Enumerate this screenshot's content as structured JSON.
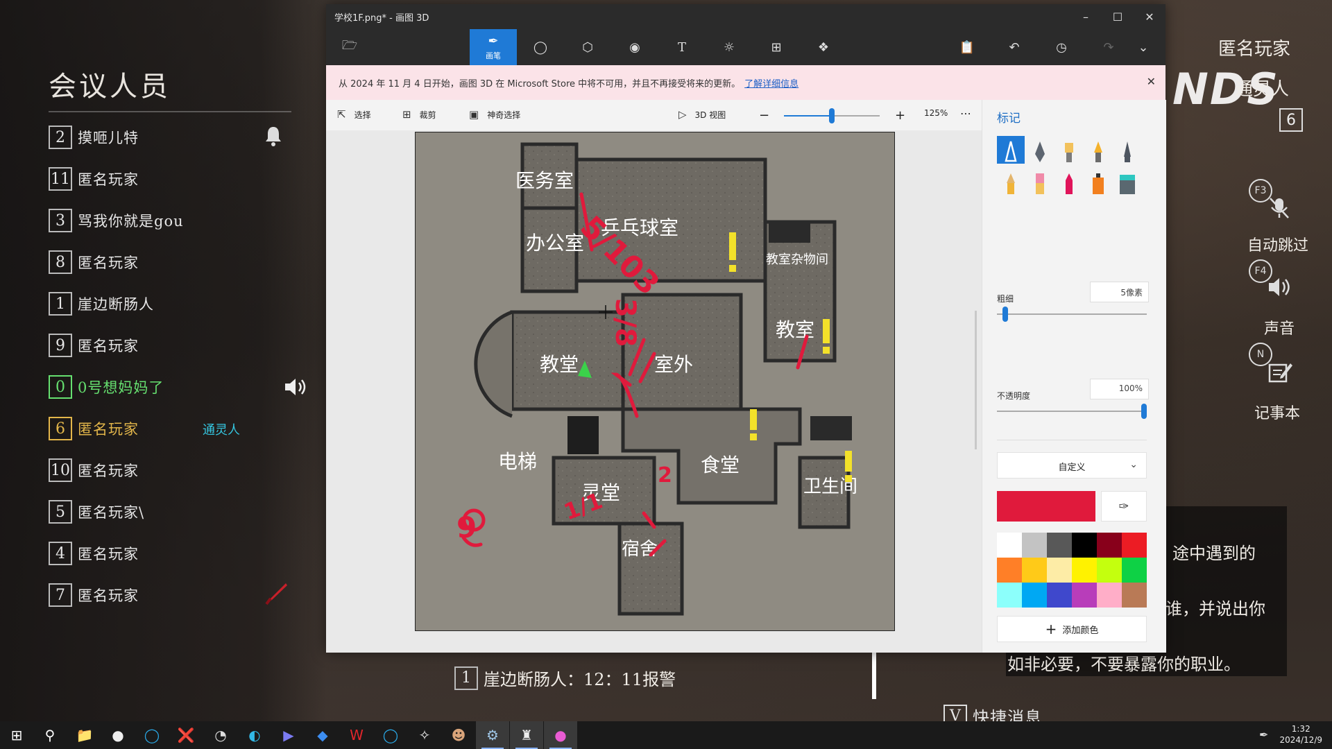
{
  "meeting": {
    "title": "会议人员",
    "players": [
      {
        "num": "2",
        "name": "摸咂儿特"
      },
      {
        "num": "11",
        "name": "匿名玩家"
      },
      {
        "num": "3",
        "name": "骂我你就是gou"
      },
      {
        "num": "8",
        "name": "匿名玩家"
      },
      {
        "num": "1",
        "name": "崖边断肠人"
      },
      {
        "num": "9",
        "name": "匿名玩家"
      },
      {
        "num": "0",
        "name": "0号想妈妈了",
        "status": "speaking"
      },
      {
        "num": "6",
        "name": "匿名玩家",
        "role": "通灵人"
      },
      {
        "num": "10",
        "name": "匿名玩家"
      },
      {
        "num": "5",
        "name": "匿名玩家\\"
      },
      {
        "num": "4",
        "name": "匿名玩家"
      },
      {
        "num": "7",
        "name": "匿名玩家"
      }
    ]
  },
  "hud": {
    "self_name": "匿名玩家",
    "self_role": "通灵人",
    "self_number": "6",
    "logo_text": "NDS",
    "key_f3": "F3",
    "auto_skip": "自动跳过",
    "key_f4": "F4",
    "sound": "声音",
    "key_n": "N",
    "notebook": "记事本",
    "info_lines": [
      "途中遇到的",
      "谁，并说出你",
      "如非必要，不要暴露你的职业。"
    ],
    "chat": {
      "num": "1",
      "text": "崖边断肠人：12：11报警"
    },
    "quick_msg": {
      "key": "V",
      "text": "快捷消息"
    }
  },
  "paint3d": {
    "window_title": "学校1F.png* - 画图 3D",
    "toolbar": {
      "brushes_label": "画笔"
    },
    "notice": {
      "text": "从 2024 年 11 月 4 日开始，画图 3D 在 Microsoft Store 中将不可用，并且不再接受将来的更新。",
      "link": "了解详细信息"
    },
    "commands": {
      "select": "选择",
      "crop": "裁剪",
      "magic_select": "神奇选择",
      "view3d": "3D 视图",
      "zoom": "125%"
    },
    "zoom_level": 0.5,
    "side_panel": {
      "title": "标记",
      "thickness_label": "粗细",
      "thickness_value": "5像素",
      "thickness_level": 0.04,
      "opacity_label": "不透明度",
      "opacity_value": "100%",
      "opacity_level": 1.0,
      "color_mode": "自定义",
      "selected_color": "#e01a3c",
      "add_color_label": "添加颜色",
      "palette": [
        "#ffffff",
        "#c3c3c3",
        "#585858",
        "#000000",
        "#88001b",
        "#ec1c24",
        "#ff7f27",
        "#ffca18",
        "#fdeca6",
        "#fff200",
        "#c4ff0e",
        "#0ed145",
        "#8cfffb",
        "#00a8f3",
        "#3f48cc",
        "#b83dba",
        "#ffaec8",
        "#b97a56"
      ]
    },
    "map": {
      "rooms": {
        "infirmary": "医务室",
        "office": "办公室",
        "pingpong": "乒乓球室",
        "storage": "教室杂物间",
        "chapel": "教堂",
        "outdoor": "室外",
        "classroom": "教室",
        "elevator": "电梯",
        "spirit_hall": "灵堂",
        "canteen": "食堂",
        "toilet": "卫生间",
        "dorm": "宿舍"
      },
      "annotations": {
        "a": "5/103",
        "b": "3/8",
        "c": "9",
        "d": "1/1",
        "e": "2"
      }
    }
  },
  "taskbar": {
    "time": "1:32",
    "date": "2024/12/9"
  }
}
